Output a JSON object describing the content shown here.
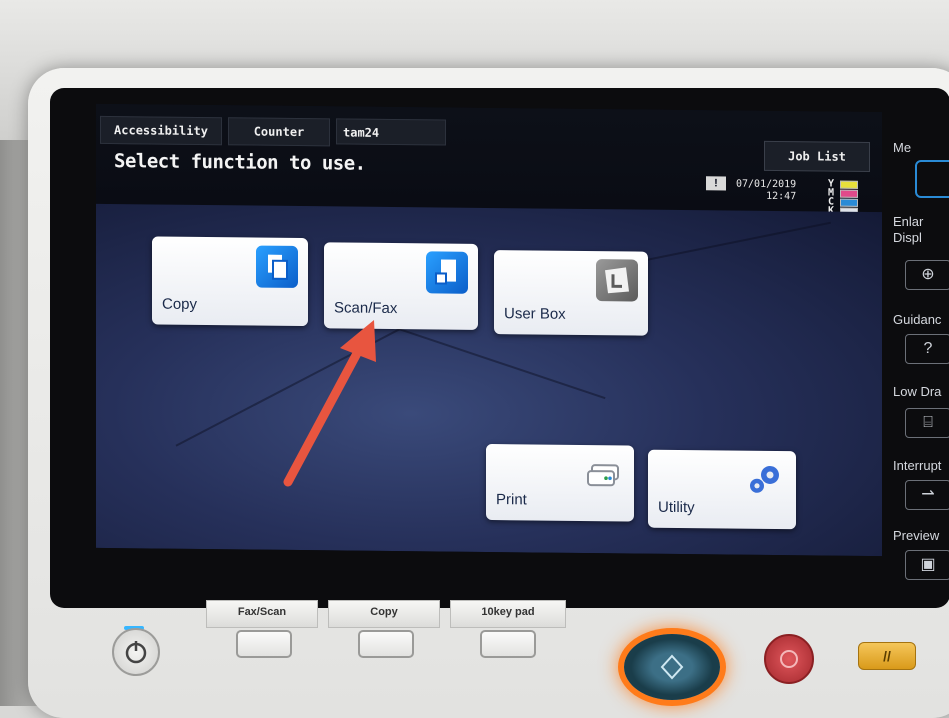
{
  "header": {
    "tabs": [
      {
        "label": "Accessibility"
      },
      {
        "label": "Counter"
      },
      {
        "label": "tam24"
      }
    ],
    "prompt": "Select function to use.",
    "job_list_label": "Job List",
    "warning_glyph": "!",
    "date": "07/01/2019",
    "time": "12:47",
    "toner": [
      {
        "name": "Y",
        "color": "#e8e03a"
      },
      {
        "name": "M",
        "color": "#e04a8a"
      },
      {
        "name": "C",
        "color": "#2a8bd6"
      },
      {
        "name": "K",
        "color": "#222222"
      }
    ]
  },
  "functions": [
    {
      "label": "Copy",
      "icon": "copy-icon"
    },
    {
      "label": "Scan/Fax",
      "icon": "scan-fax-icon"
    },
    {
      "label": "User Box",
      "icon": "user-box-icon"
    },
    {
      "label": "Print",
      "icon": "print-icon"
    },
    {
      "label": "Utility",
      "icon": "gears-icon"
    }
  ],
  "side_panel": {
    "top_cut": "Me",
    "enlarge_line1": "Enlar",
    "enlarge_line2": "Displ",
    "guidance": "Guidanc",
    "guidance_icon": "?",
    "low_line": "Low Dra",
    "interrupt": "Interrupt",
    "preview": "Preview"
  },
  "hardware": {
    "fax_scan": "Fax/Scan",
    "copy": "Copy",
    "tenkey": "10key pad"
  },
  "annotation": {
    "color": "#e8553f"
  }
}
